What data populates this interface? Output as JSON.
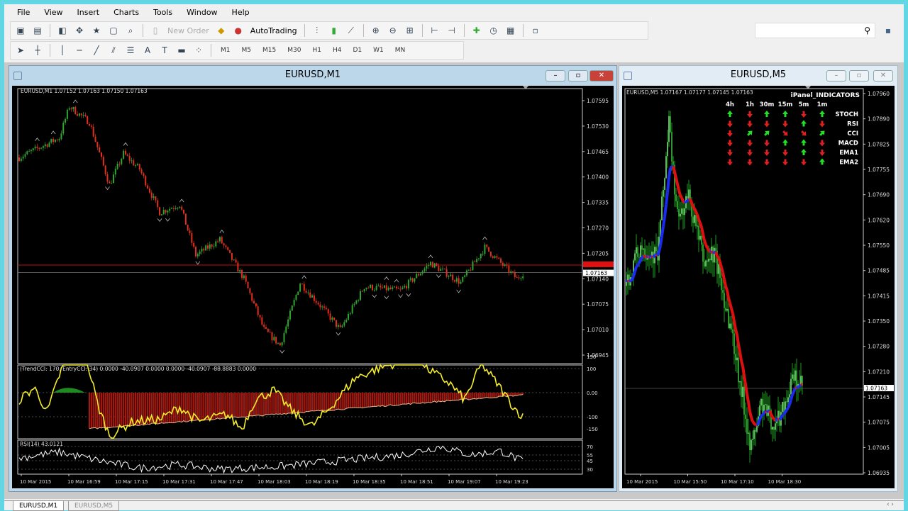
{
  "menu": [
    "File",
    "View",
    "Insert",
    "Charts",
    "Tools",
    "Window",
    "Help"
  ],
  "toolbar": {
    "new_order": "New Order",
    "autotrading": "AutoTrading",
    "timeframes": [
      "M1",
      "M5",
      "M15",
      "M30",
      "H1",
      "H4",
      "D1",
      "W1",
      "MN"
    ],
    "search_placeholder": ""
  },
  "left_window": {
    "title": "EURUSD,M1",
    "info": "EURUSD,M1 1.07152 1.07163 1.07150 1.07163",
    "price_labels": [
      "1.07595",
      "1.07530",
      "1.07465",
      "1.07400",
      "1.07335",
      "1.07270",
      "1.07205",
      "1.07140",
      "1.07075",
      "1.07010",
      "1.06945"
    ],
    "price_range": [
      1.06945,
      1.07595
    ],
    "current_price": "1.07163",
    "red_level": 1.07175,
    "price_path": [
      [
        0,
        1.0745
      ],
      [
        20,
        1.075
      ],
      [
        25,
        1.0758
      ],
      [
        35,
        1.0754
      ],
      [
        45,
        1.0738
      ],
      [
        52,
        1.0746
      ],
      [
        60,
        1.0742
      ],
      [
        70,
        1.0731
      ],
      [
        80,
        1.0733
      ],
      [
        88,
        1.072
      ],
      [
        100,
        1.0724
      ],
      [
        112,
        1.0714
      ],
      [
        122,
        1.0701
      ],
      [
        130,
        1.0697
      ],
      [
        140,
        1.0713
      ],
      [
        152,
        1.0706
      ],
      [
        160,
        1.0701
      ],
      [
        172,
        1.0712
      ],
      [
        190,
        1.0711
      ],
      [
        205,
        1.0718
      ],
      [
        220,
        1.0713
      ],
      [
        232,
        1.0722
      ],
      [
        248,
        1.0714
      ],
      [
        252,
        1.0716
      ]
    ],
    "cci": {
      "info": "(TrendCCI: 170, EntryCCI: 34) 0.0000 -40.0907 0.0000 0.0000 -40.0907 -88.8883 0.0000",
      "levels": [
        "150",
        "100",
        "0.00",
        "-100",
        "-150"
      ]
    },
    "rsi": {
      "info": "RSI(14) 43.0121",
      "levels": [
        "70",
        "55",
        "45",
        "30"
      ]
    },
    "time_labels": [
      "10 Mar 2015",
      "10 Mar 16:59",
      "10 Mar 17:15",
      "10 Mar 17:31",
      "10 Mar 17:47",
      "10 Mar 18:03",
      "10 Mar 18:19",
      "10 Mar 18:35",
      "10 Mar 18:51",
      "10 Mar 19:07",
      "10 Mar 19:23"
    ]
  },
  "right_window": {
    "title": "EURUSD,M5",
    "info": "EURUSD,M5 1.07167 1.07177 1.07145 1.07163",
    "price_labels": [
      "1.07960",
      "1.07890",
      "1.07825",
      "1.07755",
      "1.07690",
      "1.07620",
      "1.07550",
      "1.07485",
      "1.07415",
      "1.07350",
      "1.07280",
      "1.07210",
      "1.07145",
      "1.07075",
      "1.07005",
      "1.06935"
    ],
    "price_range": [
      1.06935,
      1.0796
    ],
    "current_price": "1.07163",
    "price_path": [
      [
        0,
        1.0744
      ],
      [
        10,
        1.0755
      ],
      [
        22,
        1.0752
      ],
      [
        30,
        1.0788
      ],
      [
        36,
        1.0762
      ],
      [
        44,
        1.0768
      ],
      [
        55,
        1.075
      ],
      [
        62,
        1.0753
      ],
      [
        75,
        1.073
      ],
      [
        88,
        1.07
      ],
      [
        95,
        1.0712
      ],
      [
        105,
        1.0706
      ],
      [
        118,
        1.0719
      ],
      [
        125,
        1.0716
      ]
    ],
    "time_labels": [
      "10 Mar 2015",
      "10 Mar 15:50",
      "10 Mar 17:10",
      "10 Mar 18:30"
    ],
    "panel": {
      "title": "iPanel_INDICATORS",
      "columns": [
        "4h",
        "1h",
        "30m",
        "15m",
        "5m",
        "1m"
      ],
      "rows": [
        {
          "name": "STOCH",
          "signals": [
            "up",
            "down",
            "up",
            "up",
            "down",
            "up"
          ]
        },
        {
          "name": "RSI",
          "signals": [
            "down",
            "down",
            "down",
            "down",
            "up",
            "down"
          ]
        },
        {
          "name": "CCI",
          "signals": [
            "down",
            "up-right",
            "up-right",
            "down-right",
            "down-right",
            "up-right"
          ]
        },
        {
          "name": "MACD",
          "signals": [
            "down",
            "down",
            "down",
            "up",
            "up",
            "down"
          ]
        },
        {
          "name": "EMA1",
          "signals": [
            "down",
            "down",
            "down",
            "down",
            "up",
            "down"
          ]
        },
        {
          "name": "EMA2",
          "signals": [
            "down",
            "down",
            "down",
            "down",
            "down",
            "up"
          ]
        }
      ]
    }
  },
  "tabs": [
    "EURUSD,M1",
    "EURUSD,M5"
  ],
  "colors": {
    "bull": "#2fa52f",
    "bear": "#e0301e",
    "cci": "#f5ee2a",
    "hist": "#a11a12",
    "ma_red": "#e01010",
    "ma_blue": "#1a2cf0",
    "up": "#22e022",
    "down": "#e02020"
  }
}
